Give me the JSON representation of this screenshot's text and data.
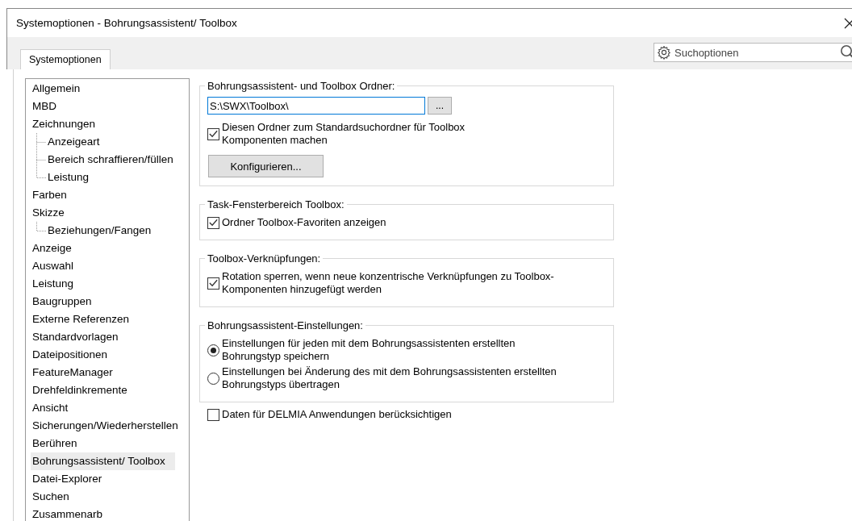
{
  "window": {
    "title": "Systemoptionen - Bohrungsassistent/ Toolbox"
  },
  "tabs": [
    {
      "label": "Systemoptionen",
      "selected": true
    }
  ],
  "search": {
    "placeholder": "Suchoptionen"
  },
  "tree": [
    {
      "label": "Allgemein",
      "selected": false
    },
    {
      "label": "MBD",
      "selected": false
    },
    {
      "label": "Zeichnungen",
      "selected": false,
      "children": [
        {
          "label": "Anzeigeart",
          "selected": false
        },
        {
          "label": "Bereich schraffieren/füllen",
          "selected": false
        },
        {
          "label": "Leistung",
          "selected": false
        }
      ]
    },
    {
      "label": "Farben",
      "selected": false
    },
    {
      "label": "Skizze",
      "selected": false,
      "children": [
        {
          "label": "Beziehungen/Fangen",
          "selected": false
        }
      ]
    },
    {
      "label": "Anzeige",
      "selected": false
    },
    {
      "label": "Auswahl",
      "selected": false
    },
    {
      "label": "Leistung",
      "selected": false
    },
    {
      "label": "Baugruppen",
      "selected": false
    },
    {
      "label": "Externe Referenzen",
      "selected": false
    },
    {
      "label": "Standardvorlagen",
      "selected": false
    },
    {
      "label": "Dateipositionen",
      "selected": false
    },
    {
      "label": "FeatureManager",
      "selected": false
    },
    {
      "label": "Drehfeldinkremente",
      "selected": false
    },
    {
      "label": "Ansicht",
      "selected": false
    },
    {
      "label": "Sicherungen/Wiederherstellen",
      "selected": false
    },
    {
      "label": "Berühren",
      "selected": false
    },
    {
      "label": "Bohrungsassistent/ Toolbox",
      "selected": true
    },
    {
      "label": "Datei-Explorer",
      "selected": false
    },
    {
      "label": "Suchen",
      "selected": false
    },
    {
      "label": "Zusammenarb",
      "selected": false
    }
  ],
  "groups": [
    {
      "title": "Bohrungsassistent- und Toolbox Ordner:",
      "items": [
        {
          "kind": "path",
          "value": "S:\\SWX\\Toolbox\\",
          "browse": "..."
        },
        {
          "kind": "checkbox",
          "label": "Diesen Ordner zum Standardsuchordner für Toolbox Komponenten machen",
          "checked": true
        },
        {
          "kind": "button",
          "label": "Konfigurieren..."
        }
      ]
    },
    {
      "title": "Task-Fensterbereich Toolbox:",
      "items": [
        {
          "kind": "checkbox",
          "label": "Ordner Toolbox-Favoriten anzeigen",
          "checked": true
        }
      ]
    },
    {
      "title": "Toolbox-Verknüpfungen:",
      "items": [
        {
          "kind": "checkbox",
          "label": "Rotation sperren, wenn neue konzentrische Verknüpfungen zu Toolbox-Komponenten hinzugefügt werden",
          "checked": true
        }
      ]
    },
    {
      "title": "Bohrungsassistent-Einstellungen:",
      "items": [
        {
          "kind": "radio",
          "label": "Einstellungen für jeden mit dem Bohrungsassistenten erstellten Bohrungstyp speichern",
          "selected": true
        },
        {
          "kind": "radio",
          "label": "Einstellungen bei Änderung des mit dem Bohrungsassistenten erstellten Bohrungstyps übertragen",
          "selected": false
        }
      ]
    }
  ],
  "extra": {
    "label": "Daten für DELMIA Anwendungen berücksichtigen",
    "checked": false
  }
}
